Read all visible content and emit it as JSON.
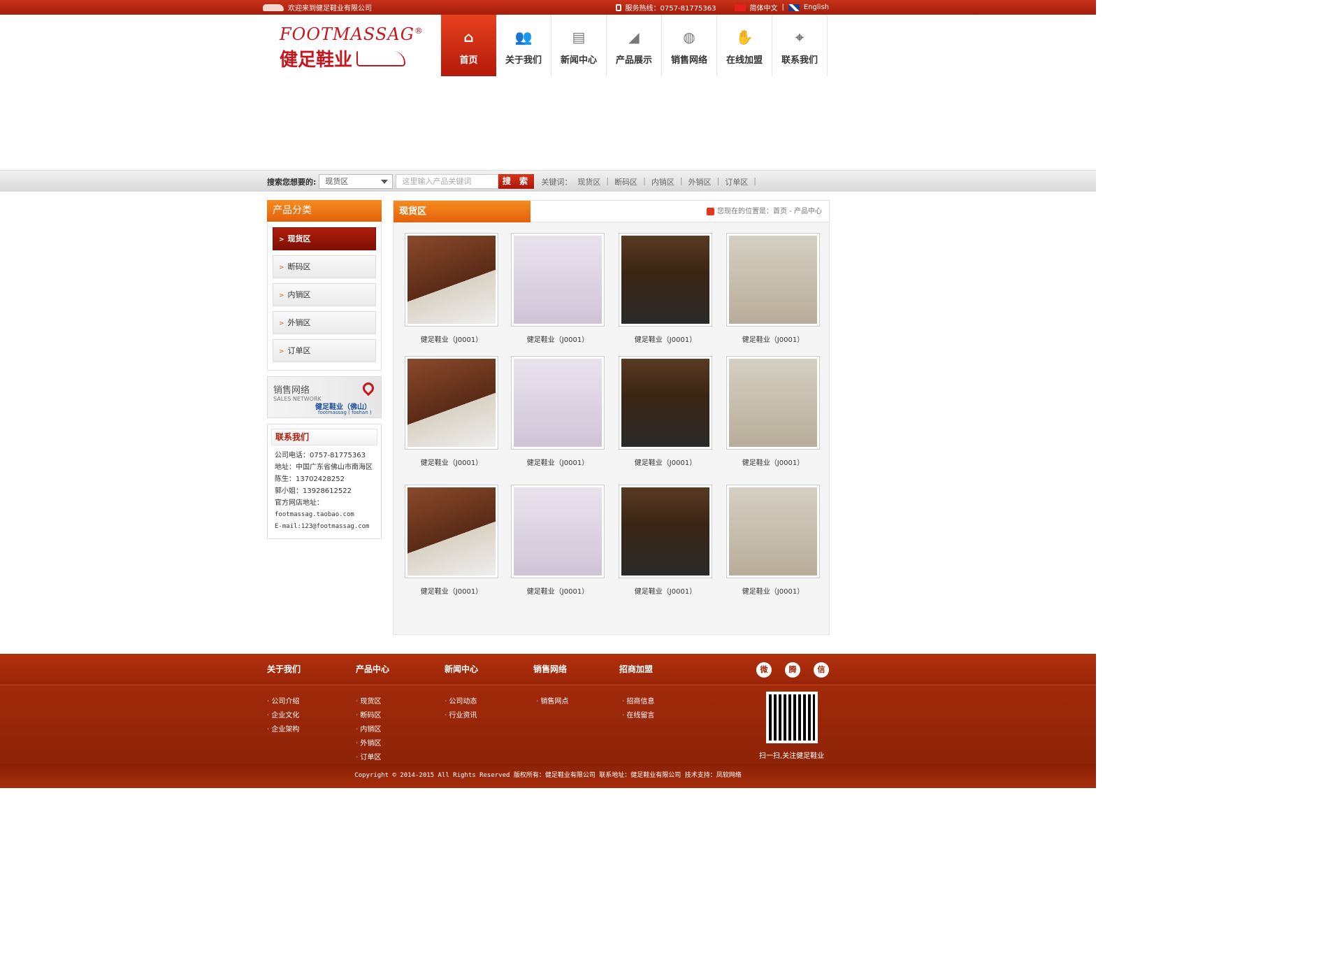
{
  "topbar": {
    "welcome": "欢迎来到健足鞋业有限公司",
    "hotline": "服务热线：0757-81775363",
    "lang_cn": "简体中文",
    "lang_sep": "|",
    "lang_en": "English"
  },
  "logo": {
    "en": "FOOTMASSAG",
    "registered": "®",
    "cn": "健足鞋业"
  },
  "nav": [
    {
      "label": "首页",
      "icon": "home-icon",
      "glyph": "⌂"
    },
    {
      "label": "关于我们",
      "icon": "users-icon",
      "glyph": "👥"
    },
    {
      "label": "新闻中心",
      "icon": "newspaper-icon",
      "glyph": "▤"
    },
    {
      "label": "产品展示",
      "icon": "shoe-icon",
      "glyph": "◢"
    },
    {
      "label": "销售网络",
      "icon": "globe-icon",
      "glyph": "◍"
    },
    {
      "label": "在线加盟",
      "icon": "handshake-icon",
      "glyph": "✋"
    },
    {
      "label": "联系我们",
      "icon": "map-pin-icon",
      "glyph": "⌖"
    }
  ],
  "search": {
    "label": "搜索您想要的:",
    "select_value": "现货区",
    "placeholder": "这里输入产品关键词",
    "button": "搜 索",
    "keywords_label": "关键词：",
    "keywords": [
      "现货区",
      "断码区",
      "内销区",
      "外销区",
      "订单区"
    ]
  },
  "sidebar": {
    "category_title": "产品分类",
    "categories": [
      "现货区",
      "断码区",
      "内销区",
      "外销区",
      "订单区"
    ],
    "sales_network": {
      "title": "销售网络",
      "subtitle": "SALES NETWORK",
      "brand": "健足鞋业（佛山）",
      "brand_en": "footmassag ( foshan )"
    },
    "contact": {
      "title": "联系我们",
      "phone": "公司电话：0757-81775363",
      "address": "地址：中国广东省佛山市南海区",
      "person1": "陈生：13702428252",
      "person2": "郭小姐：13928612522",
      "store_label": "官方网店地址：",
      "store_url": "footmassag.taobao.com",
      "email": "E-mail:123@footmassag.com"
    }
  },
  "content": {
    "tab": "现货区",
    "breadcrumb": "您现在的位置是：首页 - 产品中心",
    "products": [
      "健足鞋业（J0001）",
      "健足鞋业（J0001）",
      "健足鞋业（J0001）",
      "健足鞋业（J0001）",
      "健足鞋业（J0001）",
      "健足鞋业（J0001）",
      "健足鞋业（J0001）",
      "健足鞋业（J0001）",
      "健足鞋业（J0001）",
      "健足鞋业（J0001）",
      "健足鞋业（J0001）",
      "健足鞋业（J0001）"
    ]
  },
  "footer": {
    "columns": [
      {
        "title": "关于我们",
        "items": [
          "· 公司介绍",
          "· 企业文化",
          "· 企业架构"
        ]
      },
      {
        "title": "产品中心",
        "items": [
          "· 现货区",
          "· 断码区",
          "· 内销区",
          "· 外销区",
          "· 订单区"
        ]
      },
      {
        "title": "新闻中心",
        "items": [
          "· 公司动态",
          "· 行业资讯"
        ]
      },
      {
        "title": "销售网络",
        "items": [
          "· 销售网点"
        ]
      },
      {
        "title": "招商加盟",
        "items": [
          "· 招商信息",
          "· 在线留言"
        ]
      }
    ],
    "social": [
      {
        "icon": "weibo-icon",
        "glyph": "微"
      },
      {
        "icon": "tencent-weibo-icon",
        "glyph": "腾"
      },
      {
        "icon": "wechat-icon",
        "glyph": "信"
      }
    ],
    "qr_caption": "扫一扫,关注健足鞋业",
    "copyright": "Copyright © 2014-2015 All Rights Reserved 版权所有：健足鞋业有限公司 联系地址：健足鞋业有限公司   技术支持：凤软网络"
  },
  "colors": {
    "brand_red": "#c4161c",
    "nav_active": "#d12c12",
    "accent_orange": "#f08a1c",
    "footer_bg": "#9c2708"
  }
}
